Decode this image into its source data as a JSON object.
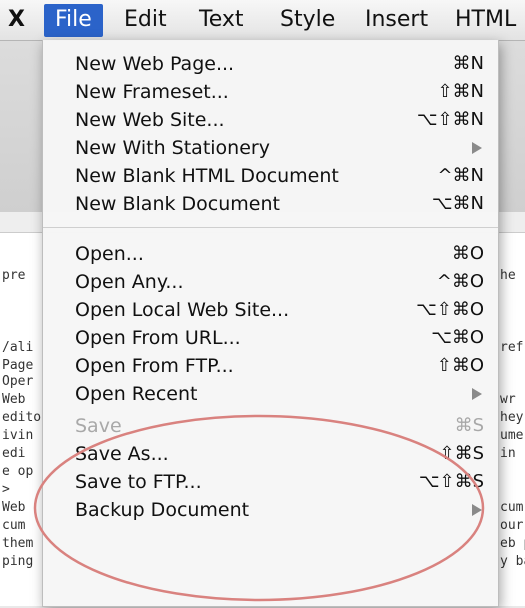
{
  "menubar": {
    "items": [
      {
        "label": "X"
      },
      {
        "label": "File"
      },
      {
        "label": "Edit"
      },
      {
        "label": "Text"
      },
      {
        "label": "Style"
      },
      {
        "label": "Insert"
      },
      {
        "label": "HTML"
      }
    ]
  },
  "file_menu": {
    "groups": [
      [
        {
          "label": "New Web Page...",
          "shortcut": "⌘N"
        },
        {
          "label": "New Frameset...",
          "shortcut": "⇧⌘N"
        },
        {
          "label": "New Web Site...",
          "shortcut": "⌥⇧⌘N"
        },
        {
          "label": "New With Stationery",
          "submenu": true
        },
        {
          "label": "New Blank HTML Document",
          "shortcut": "^⌘N"
        },
        {
          "label": "New Blank Document",
          "shortcut": "⌥⌘N"
        }
      ],
      [
        {
          "label": "Open...",
          "shortcut": "⌘O"
        },
        {
          "label": "Open Any...",
          "shortcut": "^⌘O"
        },
        {
          "label": "Open Local Web Site...",
          "shortcut": "⌥⇧⌘O"
        },
        {
          "label": "Open From URL...",
          "shortcut": "⌥⌘O"
        },
        {
          "label": "Open From FTP...",
          "shortcut": "⇧⌘O"
        },
        {
          "label": "Open Recent",
          "submenu": true
        },
        {
          "label": "Save",
          "shortcut": "⌘S",
          "disabled": true
        },
        {
          "label": "Save As...",
          "shortcut": "⇧⌘S"
        },
        {
          "label": "Save to FTP...",
          "shortcut": "⌥⇧⌘S"
        },
        {
          "label": "Backup Document",
          "submenu": true
        }
      ]
    ]
  },
  "background_text": {
    "lines": [
      {
        "text": "pre"
      },
      {
        "text": "/ali"
      },
      {
        "text": "Page"
      },
      {
        "text": "Oper"
      },
      {
        "text": "Web"
      },
      {
        "text": "edito"
      },
      {
        "text": "ivin"
      },
      {
        "text": " edi"
      },
      {
        "text": "e op"
      },
      {
        "text": ">"
      },
      {
        "text": "Web"
      },
      {
        "text": "cum"
      },
      {
        "text": "them"
      },
      {
        "text": "ping"
      }
    ],
    "right_fragments": [
      {
        "text": "he"
      },
      {
        "text": "ref."
      },
      {
        "text": "wr"
      },
      {
        "text": "hey"
      },
      {
        "text": "ume"
      },
      {
        "text": "in"
      },
      {
        "text": "cum"
      },
      {
        "text": "our"
      },
      {
        "text": "eb p"
      },
      {
        "text": "y ba"
      }
    ]
  },
  "colors": {
    "menu_highlight": "#2b63c9",
    "annotation": "#d9827f"
  }
}
